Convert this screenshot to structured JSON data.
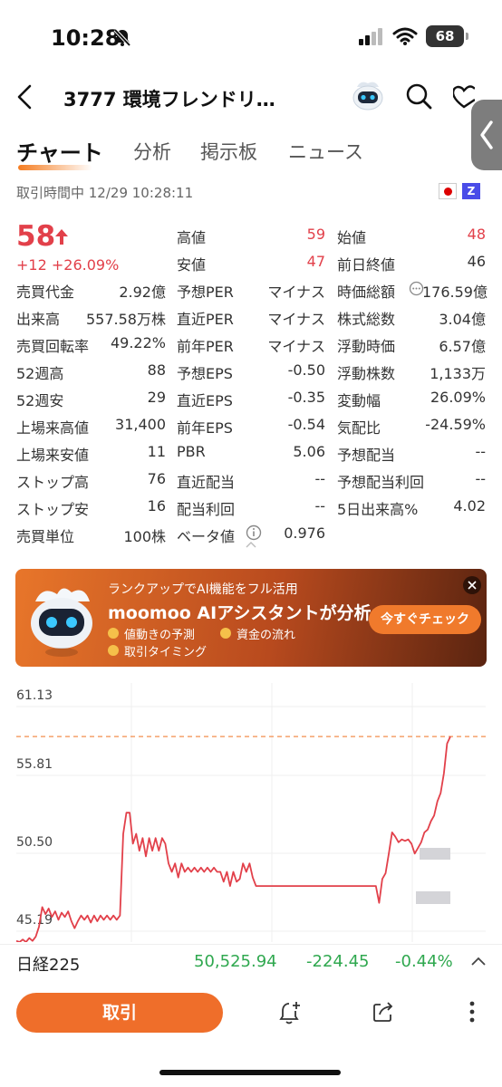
{
  "status_bar": {
    "time": "10:28",
    "battery": "68"
  },
  "nav": {
    "title": "3777  環境フレンドリ…"
  },
  "tabs": [
    "チャート",
    "分析",
    "掲示板",
    "ニュース"
  ],
  "trade_time": "取引時間中 12/29 10:28:11",
  "flags": {
    "second": "Z"
  },
  "price": {
    "current": "58",
    "change": "+12 +26.09%"
  },
  "stats": {
    "col1": [
      {
        "label": "売買代金",
        "value": "2.92億"
      },
      {
        "label": "出来高",
        "value": "557.58万株"
      },
      {
        "label": "売買回転率",
        "value": "49.22%"
      },
      {
        "label": "52週高",
        "value": "88"
      },
      {
        "label": "52週安",
        "value": "29"
      },
      {
        "label": "上場来高値",
        "value": "31,400"
      },
      {
        "label": "上場来安値",
        "value": "11"
      },
      {
        "label": "ストップ高",
        "value": "76"
      },
      {
        "label": "ストップ安",
        "value": "16"
      },
      {
        "label": "売買単位",
        "value": "100株"
      }
    ],
    "col2": [
      {
        "label": "高値",
        "value": "59",
        "color": "red"
      },
      {
        "label": "安値",
        "value": "47",
        "color": "red"
      },
      {
        "label": "予想PER",
        "value": "マイナス"
      },
      {
        "label": "直近PER",
        "value": "マイナス"
      },
      {
        "label": "前年PER",
        "value": "マイナス"
      },
      {
        "label": "予想EPS",
        "value": "-0.50"
      },
      {
        "label": "直近EPS",
        "value": "-0.35"
      },
      {
        "label": "前年EPS",
        "value": "-0.54"
      },
      {
        "label": "PBR",
        "value": "5.06"
      },
      {
        "label": "直近配当",
        "value": "--"
      },
      {
        "label": "配当利回",
        "value": "--"
      },
      {
        "label": "ベータ値",
        "value": "0.976"
      }
    ],
    "col3": [
      {
        "label": "始値",
        "value": "48",
        "color": "red"
      },
      {
        "label": "前日終値",
        "value": "46"
      },
      {
        "label": "時価総額",
        "value": "176.59億"
      },
      {
        "label": "株式総数",
        "value": "3.04億"
      },
      {
        "label": "浮動時価",
        "value": "6.57億"
      },
      {
        "label": "浮動株数",
        "value": "1,133万"
      },
      {
        "label": "変動幅",
        "value": "26.09%"
      },
      {
        "label": "気配比",
        "value": "-24.59%"
      },
      {
        "label": "予想配当",
        "value": "--"
      },
      {
        "label": "予想配当利回",
        "value": "--"
      },
      {
        "label": "5日出来高%",
        "value": "4.02"
      }
    ]
  },
  "banner": {
    "subtitle": "ランクアップでAI機能をフル活用",
    "title": "moomoo AIアシスタントが分析",
    "items": [
      "値動きの予測",
      "資金の流れ",
      "取引タイミング"
    ],
    "cta": "今すぐチェック"
  },
  "chart_data": {
    "type": "line",
    "y_ticks": [
      "61.13",
      "55.81",
      "50.50",
      "45.19"
    ],
    "ylim": [
      44.0,
      61.13
    ],
    "reference_line": 59.0,
    "series": [
      {
        "values": [
          44.5,
          44.3,
          44.6,
          44.4,
          44.7,
          44.5,
          44.8,
          45.5,
          46.9,
          46.4,
          46.8,
          46.2,
          46.6,
          46.0,
          46.5,
          46.2,
          46.6,
          45.9,
          45.4,
          45.9,
          46.3,
          46.0,
          46.3,
          45.8,
          46.3,
          45.9,
          46.3,
          46.0,
          46.3,
          46.0,
          46.3,
          46.0,
          46.3,
          52.1,
          53.6,
          53.6,
          51.4,
          52.1,
          50.9,
          51.8,
          50.5,
          51.8,
          50.9,
          51.8,
          50.9,
          51.8,
          51.4,
          50.0,
          49.4,
          50.0,
          49.0,
          50.0,
          49.4,
          49.7,
          49.4,
          49.7,
          49.4,
          49.7,
          49.4,
          49.7,
          49.4,
          49.7,
          49.4,
          49.4,
          48.7,
          49.4,
          48.4,
          49.4,
          48.7,
          48.9,
          50.0,
          49.4,
          50.0,
          49.0,
          48.4,
          48.4,
          48.4,
          48.4,
          48.4,
          48.4,
          48.4,
          48.4,
          48.4,
          48.4,
          48.4,
          48.4,
          48.4,
          48.4,
          48.4,
          48.4,
          48.4,
          48.4,
          48.4,
          48.4,
          48.4,
          48.4,
          48.4,
          48.4,
          48.4,
          48.4,
          48.4,
          48.4,
          48.4,
          48.4,
          48.4,
          48.4,
          48.4,
          48.4,
          48.4,
          48.4,
          48.4,
          48.4,
          47.2,
          48.9,
          49.3,
          50.7,
          52.2,
          51.9,
          51.5,
          51.7,
          51.6,
          51.7,
          51.4,
          50.7,
          51.1,
          51.5,
          52.2,
          52.4,
          53.0,
          53.4,
          54.4,
          55.0,
          56.4,
          58.5,
          59.0
        ]
      }
    ]
  },
  "index": {
    "name": "日経225",
    "value": "50,525.94",
    "change": "-224.45",
    "pct": "-0.44%"
  },
  "bottom": {
    "trade": "取引"
  }
}
